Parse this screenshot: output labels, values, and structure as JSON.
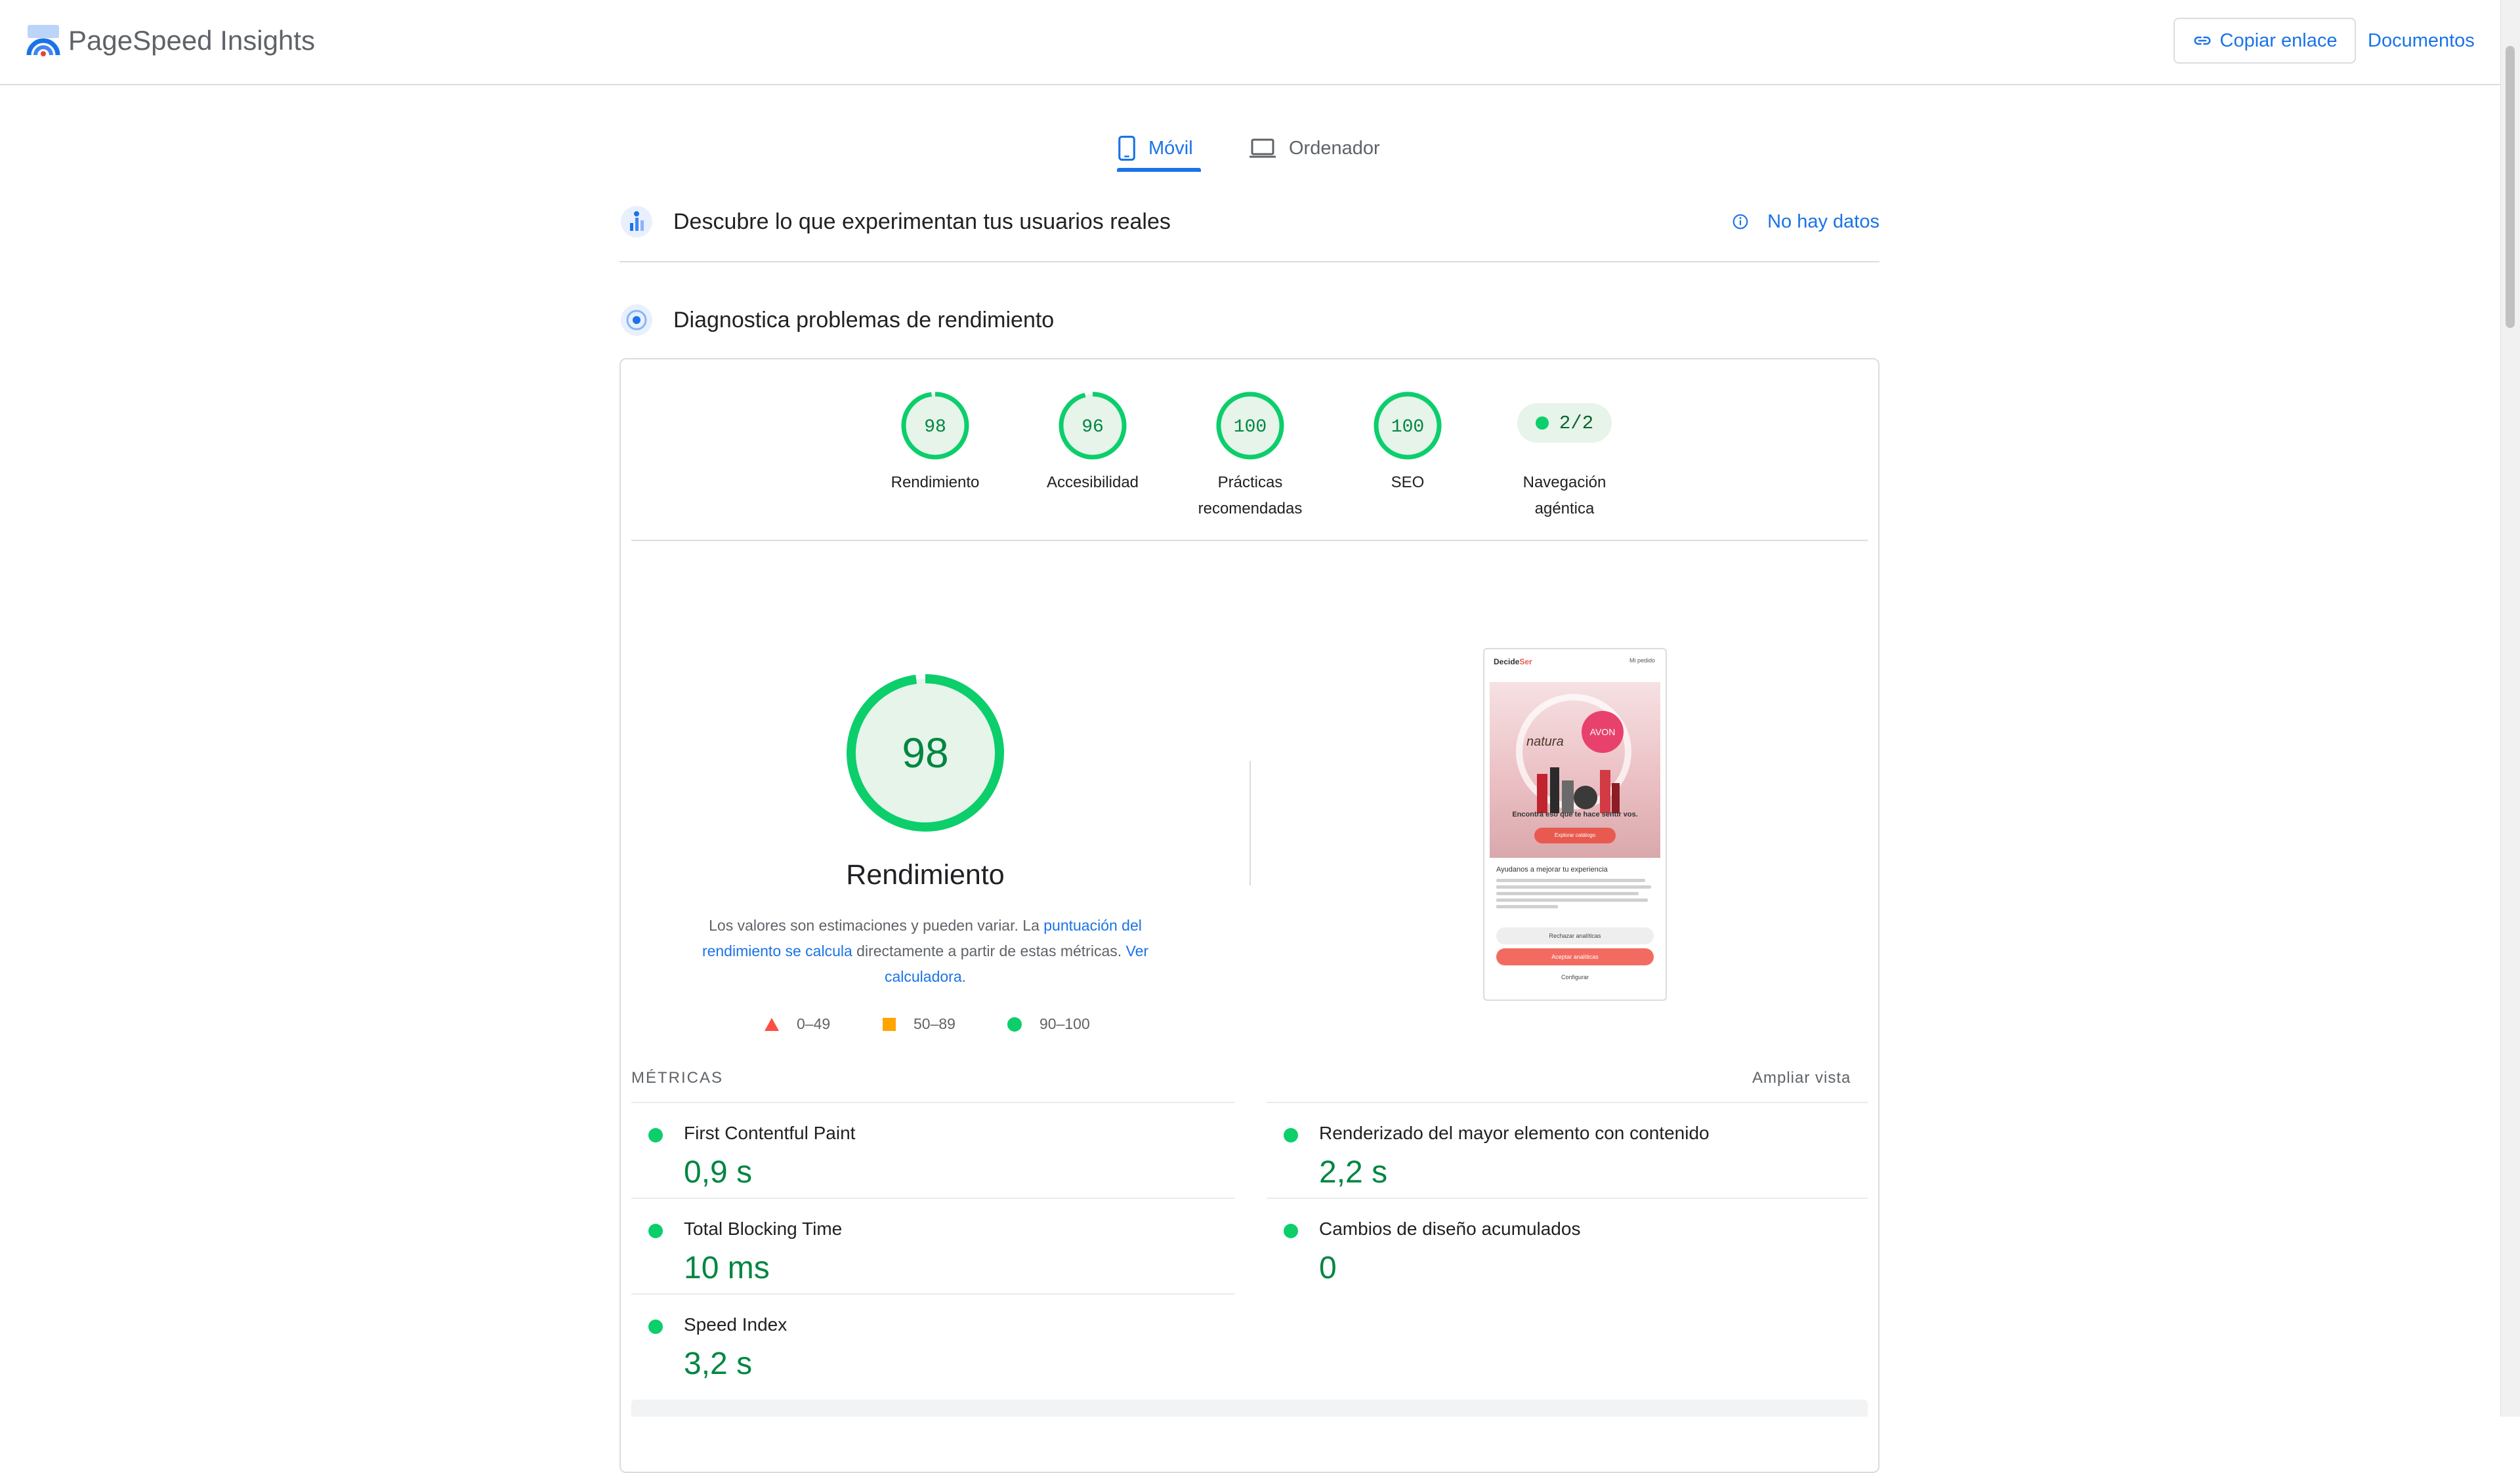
{
  "header": {
    "app_title": "PageSpeed Insights",
    "copy_link_label": "Copiar enlace",
    "docs_label": "Documentos"
  },
  "device_tabs": [
    {
      "label": "Móvil",
      "icon": "smartphone-icon",
      "active": true
    },
    {
      "label": "Ordenador",
      "icon": "laptop-icon",
      "active": false
    }
  ],
  "field_data": {
    "title": "Descubre lo que experimentan tus usuarios reales",
    "status": "No hay datos"
  },
  "lab": {
    "title": "Diagnostica problemas de rendimiento",
    "categories": [
      {
        "score": "98",
        "label": "Rendimiento",
        "fraction": 0.98
      },
      {
        "score": "96",
        "label": "Accesibilidad",
        "fraction": 0.96
      },
      {
        "score": "100",
        "label": "Prácticas recomendadas",
        "fraction": 1.0
      },
      {
        "score": "100",
        "label": "SEO",
        "fraction": 1.0
      },
      {
        "score": "2/2",
        "label": "Navegación agéntica"
      }
    ]
  },
  "performance": {
    "score": "98",
    "fraction": 0.98,
    "title": "Rendimiento",
    "desc_1": "Los valores son estimaciones y pueden variar. La ",
    "desc_link_1": "puntuación del rendimiento se calcula",
    "desc_2": " directamente a partir de estas métricas. ",
    "desc_link_2": "Ver calculadora",
    "desc_3": ".",
    "legend": [
      {
        "range": "0–49",
        "color": "#ff4e42"
      },
      {
        "range": "50–89",
        "color": "#ffa400"
      },
      {
        "range": "90–100",
        "color": "#0cce6b"
      }
    ]
  },
  "thumbnail": {
    "brand_a": "Decide",
    "brand_b": "Ser",
    "header_right": "Mi pedido",
    "natura": "natura",
    "avon": "AVON",
    "hero_text": "Encontrá eso que te hace sentir vos.",
    "hero_button": "Explorar catálogo",
    "cookie_title": "Ayudanos a mejorar tu experiencia",
    "btn_reject": "Rechazar analíticas",
    "btn_accept": "Aceptar analíticas",
    "btn_configure": "Configurar"
  },
  "metrics": {
    "heading": "MÉTRICAS",
    "expand_label": "Ampliar vista",
    "items": [
      {
        "name": "First Contentful Paint",
        "value": "0,9 s"
      },
      {
        "name": "Renderizado del mayor elemento con contenido",
        "value": "2,2 s"
      },
      {
        "name": "Total Blocking Time",
        "value": "10 ms"
      },
      {
        "name": "Cambios de diseño acumulados",
        "value": "0"
      },
      {
        "name": "Speed Index",
        "value": "3,2 s"
      }
    ]
  },
  "colors": {
    "accent": "#1a73e8",
    "pass": "#0cce6b",
    "pass_text": "#018642"
  }
}
